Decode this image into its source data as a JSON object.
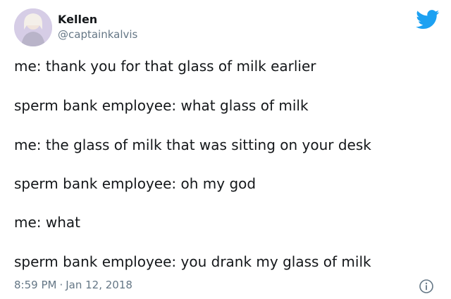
{
  "author": {
    "name": "Kellen",
    "handle": "@captainkalvis"
  },
  "tweet_lines": [
    "me: thank you for that glass of milk earlier",
    "sperm bank employee: what glass of milk",
    "me: the glass of milk that was sitting on your desk",
    "sperm bank employee: oh my god",
    "me: what",
    "sperm bank employee: you drank my glass of milk"
  ],
  "meta": {
    "time": "8:59 PM",
    "separator": "·",
    "date": "Jan 12, 2018"
  },
  "icons": {
    "brand": "twitter-bird-icon",
    "info": "info-icon"
  },
  "colors": {
    "twitter_blue": "#1da1f2",
    "text": "#14171a",
    "secondary_text": "#657786"
  }
}
